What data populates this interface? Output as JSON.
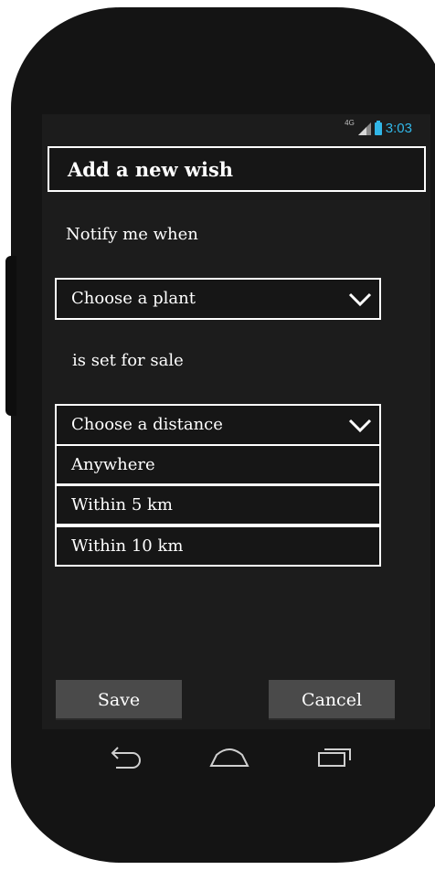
{
  "status": {
    "network": "4G",
    "time": "3:03"
  },
  "dialog": {
    "title": "Add a new wish",
    "notify_label": "Notify me when",
    "plant_select": {
      "value": "Choose a plant"
    },
    "sale_label": "is set for sale",
    "distance_select": {
      "value": "Choose a distance",
      "options": [
        "Anywhere",
        "Within 5 km",
        "Within 10 km"
      ]
    },
    "save_label": "Save",
    "cancel_label": "Cancel"
  },
  "nav": {
    "icons": [
      "back-icon",
      "home-icon",
      "recents-icon"
    ]
  },
  "colors": {
    "accent": "#31b6e7",
    "screen": "#1c1c1c",
    "button": "#4a4a4a"
  }
}
